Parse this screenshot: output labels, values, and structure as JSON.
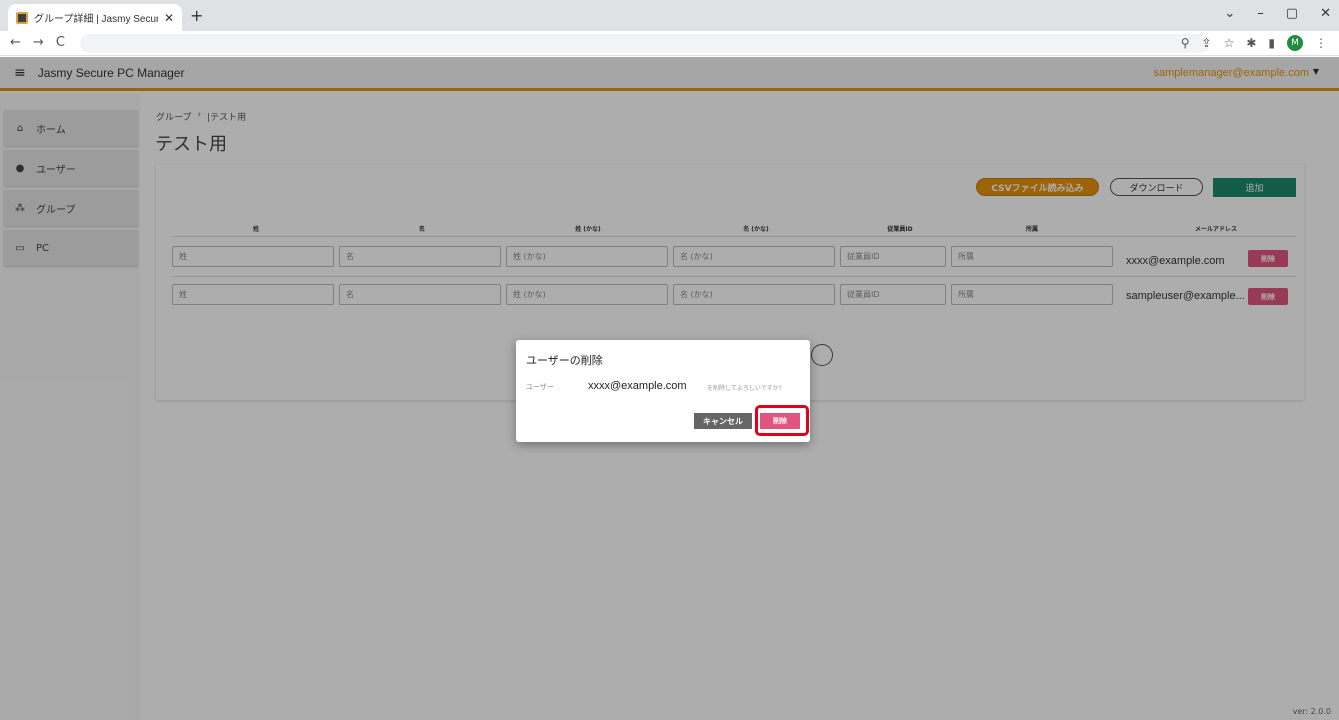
{
  "browser": {
    "tab_title": "グループ詳細 | Jasmy Secure PC M",
    "tab_close": "✕",
    "new_tab": "+",
    "window_controls": [
      "⌄",
      "–",
      "▢",
      "✕"
    ],
    "profile_initial": "M"
  },
  "app": {
    "title": "Jasmy Secure PC Manager",
    "account": "samplemanager@example.com",
    "accent_color": "#e8920c"
  },
  "sidebar": {
    "items": [
      {
        "label": "ホーム",
        "icon": "home-icon"
      },
      {
        "label": "ユーザー",
        "icon": "user-icon"
      },
      {
        "label": "グループ",
        "icon": "group-icon"
      },
      {
        "label": "PC",
        "icon": "pc-icon"
      }
    ]
  },
  "breadcrumb": {
    "parent": "グループ",
    "sep": "›",
    "current": "|テスト用"
  },
  "page_title": "テスト用",
  "toolbar": {
    "csv_label": "CSVファイル読み込み",
    "download_label": "ダウンロード",
    "add_label": "追加"
  },
  "table": {
    "headers": [
      "姓",
      "名",
      "姓 (かな)",
      "名 (かな)",
      "従業員ID",
      "所属",
      "メールアドレス"
    ],
    "placeholders": [
      "姓",
      "名",
      "姓 (かな)",
      "名 (かな)",
      "従業員ID",
      "所属"
    ],
    "rows": [
      {
        "email": "xxxx@example.com",
        "delete_label": "削除"
      },
      {
        "email": "sampleuser@example...",
        "delete_label": "削除"
      }
    ]
  },
  "dialog": {
    "title": "ユーザーの削除",
    "user_label": "ユーザー",
    "email": "xxxx@example.com",
    "confirm_text": "を削除してよろしいですか?",
    "cancel_label": "キャンセル",
    "delete_label": "削除"
  },
  "version": "ver: 2.0.0"
}
